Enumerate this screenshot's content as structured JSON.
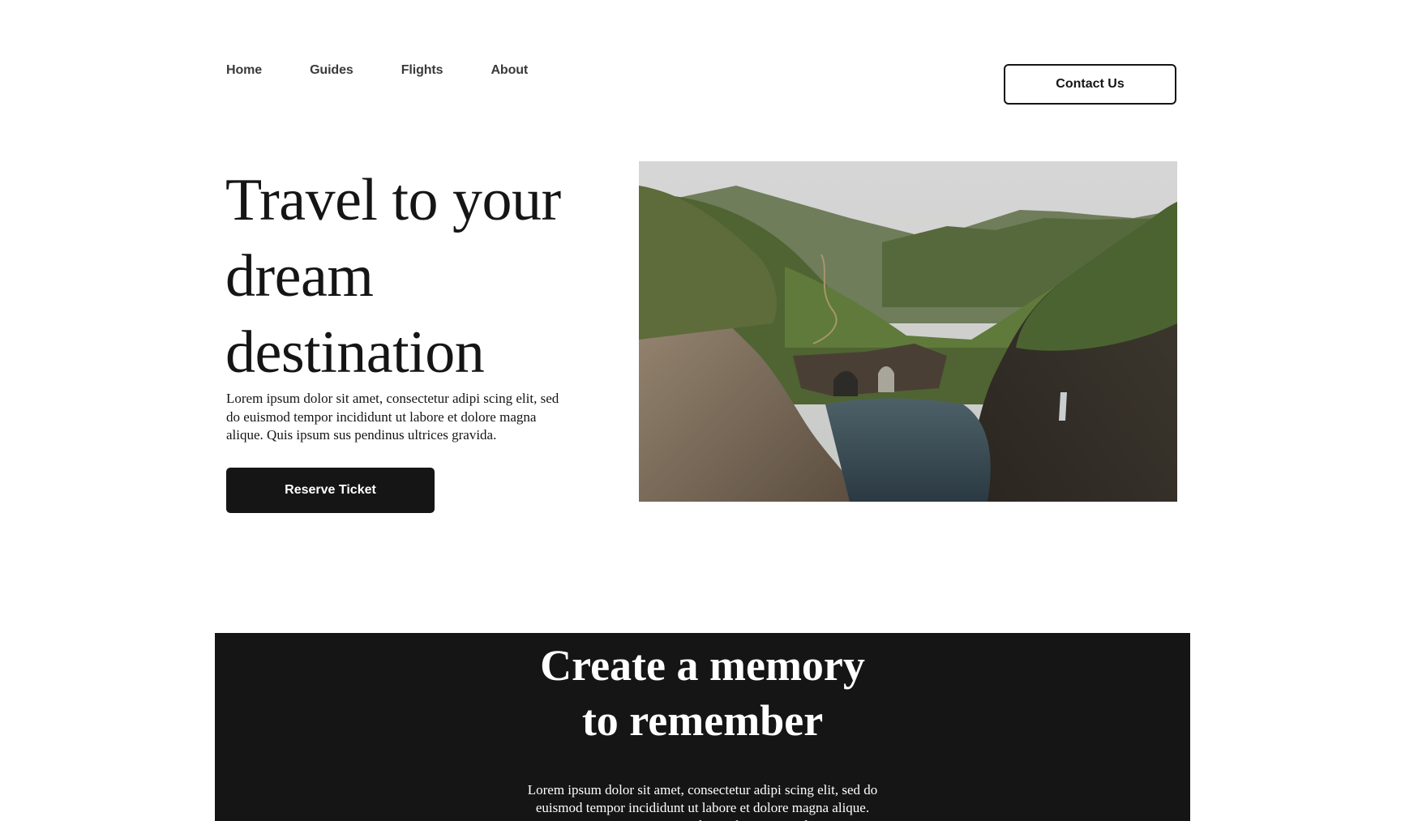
{
  "nav": {
    "items": [
      {
        "label": "Home"
      },
      {
        "label": "Guides"
      },
      {
        "label": "Flights"
      },
      {
        "label": "About"
      }
    ],
    "contact_label": "Contact Us"
  },
  "hero": {
    "title": "Travel to your dream destination",
    "text": "Lorem ipsum dolor sit amet, consectetur adipi scing elit, sed do euismod tempor incididunt ut labore et dolore magna alique. Quis ipsum sus pendinus ultrices gravida.",
    "button_label": "Reserve Ticket",
    "image_icon": "landscape-photo"
  },
  "memory": {
    "title_line1": "Create a memory",
    "title_line2": "to remember",
    "text": "Lorem ipsum dolor sit amet, consectetur adipi scing elit, sed do euismod tempor incididunt ut labore et dolore magna alique. Quis ipsum sus pendinus ultrices gravida."
  },
  "colors": {
    "primary": "#151515",
    "background": "#ffffff",
    "nav_text": "#3a3a3a"
  }
}
